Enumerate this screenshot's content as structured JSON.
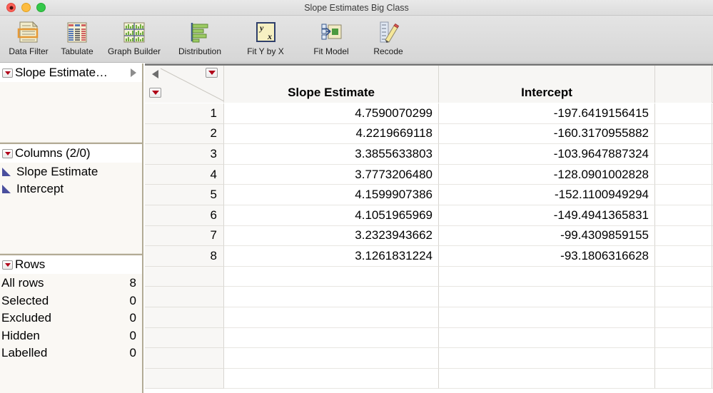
{
  "window": {
    "title": "Slope Estimates Big Class",
    "close_label": "close",
    "minimize_label": "minimize",
    "maximize_label": "maximize"
  },
  "toolbar": {
    "items": [
      {
        "label": "Data Filter",
        "icon": "data-filter-icon"
      },
      {
        "label": "Tabulate",
        "icon": "tabulate-icon"
      },
      {
        "label": "Graph Builder",
        "icon": "graph-builder-icon"
      },
      {
        "label": "Distribution",
        "icon": "distribution-icon"
      },
      {
        "label": "Fit Y by X",
        "icon": "fit-y-by-x-icon"
      },
      {
        "label": "Fit Model",
        "icon": "fit-model-icon"
      },
      {
        "label": "Recode",
        "icon": "recode-icon"
      }
    ]
  },
  "sidebar": {
    "table_panel": {
      "title": "Slope Estimate…"
    },
    "columns_panel": {
      "title": "Columns (2/0)",
      "items": [
        {
          "label": "Slope Estimate",
          "type_icon": "continuous-icon"
        },
        {
          "label": "Intercept",
          "type_icon": "continuous-icon"
        }
      ]
    },
    "rows_panel": {
      "title": "Rows",
      "stats": [
        {
          "label": "All rows",
          "value": "8"
        },
        {
          "label": "Selected",
          "value": "0"
        },
        {
          "label": "Excluded",
          "value": "0"
        },
        {
          "label": "Hidden",
          "value": "0"
        },
        {
          "label": "Labelled",
          "value": "0"
        }
      ]
    }
  },
  "table": {
    "columns": [
      "Slope Estimate",
      "Intercept"
    ],
    "rows": [
      {
        "n": "1",
        "slope": "4.7590070299",
        "intercept": "-197.6419156415"
      },
      {
        "n": "2",
        "slope": "4.2219669118",
        "intercept": "-160.3170955882"
      },
      {
        "n": "3",
        "slope": "3.3855633803",
        "intercept": "-103.9647887324"
      },
      {
        "n": "4",
        "slope": "3.7773206480",
        "intercept": "-128.0901002828"
      },
      {
        "n": "5",
        "slope": "4.1599907386",
        "intercept": "-152.1100949294"
      },
      {
        "n": "6",
        "slope": "4.1051965969",
        "intercept": "-149.4941365831"
      },
      {
        "n": "7",
        "slope": "3.2323943662",
        "intercept": "-99.4309859155"
      },
      {
        "n": "8",
        "slope": "3.1261831224",
        "intercept": "-93.1806316628"
      }
    ],
    "empty_row_count": 6
  },
  "colors": {
    "panel_divider": "#b2ab95",
    "panel_background": "#faf8f4",
    "disclosure_red": "#b00018",
    "column_type_blue": "#4a4f9e",
    "grid_line": "#d8d6d1",
    "row_header_bg": "#f8f7f5"
  }
}
